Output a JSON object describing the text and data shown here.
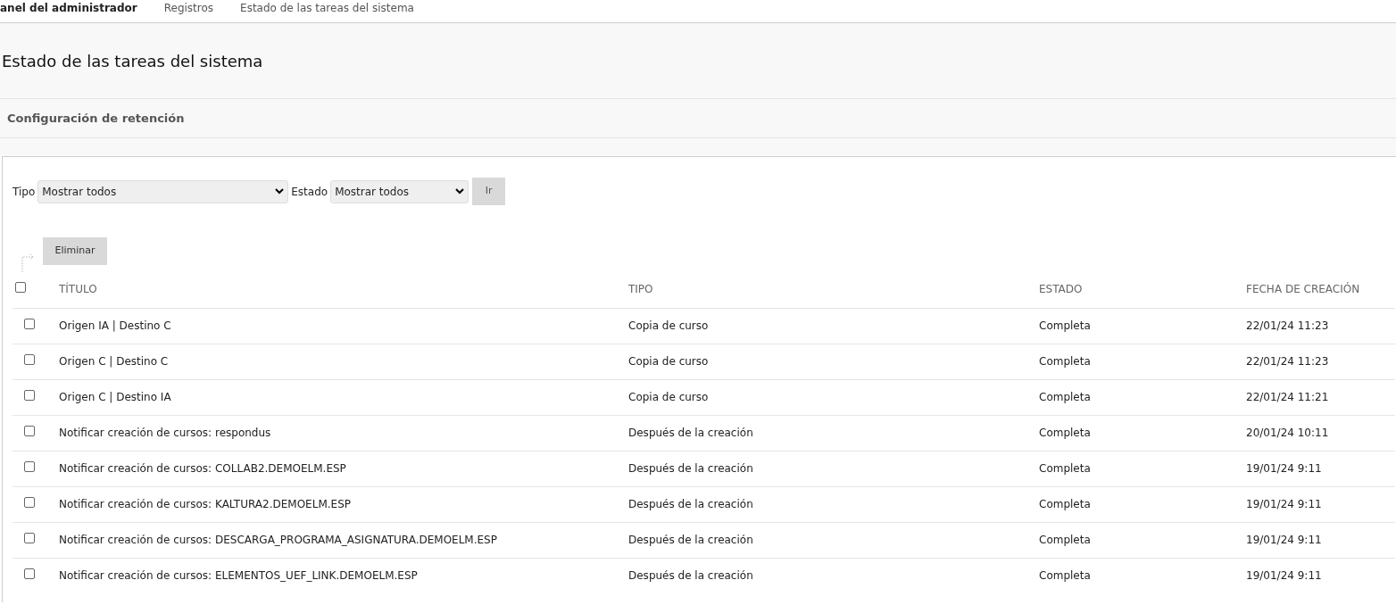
{
  "breadcrumbs": [
    "anel del administrador",
    "Registros",
    "Estado de las tareas del sistema"
  ],
  "page_title": "Estado de las tareas del sistema",
  "retention_link": "Configuración de retención",
  "filters": [
    {
      "label": "Tipo",
      "value": "Mostrar todos"
    },
    {
      "label": "Estado",
      "value": "Mostrar todos"
    }
  ],
  "go_button": "Ir",
  "delete_button": "Eliminar",
  "table": {
    "select_all": {
      "checked": false
    },
    "columns": [
      "TÍTULO",
      "TIPO",
      "ESTADO",
      "FECHA DE CREACIÓN"
    ],
    "rows": [
      {
        "checked": false,
        "cells": [
          "Origen IA | Destino C",
          "Copia de curso",
          "Completa",
          "22/01/24 11:23"
        ]
      },
      {
        "checked": false,
        "cells": [
          "Origen C | Destino C",
          "Copia de curso",
          "Completa",
          "22/01/24 11:23"
        ]
      },
      {
        "checked": false,
        "cells": [
          "Origen C | Destino IA",
          "Copia de curso",
          "Completa",
          "22/01/24 11:21"
        ]
      },
      {
        "checked": false,
        "cells": [
          "Notificar creación de cursos: respondus",
          "Después de la creación",
          "Completa",
          "20/01/24 10:11"
        ]
      },
      {
        "checked": false,
        "cells": [
          "Notificar creación de cursos: COLLAB2.DEMOELM.ESP",
          "Después de la creación",
          "Completa",
          "19/01/24 9:11"
        ]
      },
      {
        "checked": false,
        "cells": [
          "Notificar creación de cursos: KALTURA2.DEMOELM.ESP",
          "Después de la creación",
          "Completa",
          "19/01/24 9:11"
        ]
      },
      {
        "checked": false,
        "cells": [
          "Notificar creación de cursos: DESCARGA_PROGRAMA_ASIGNATURA.DEMOELM.ESP",
          "Después de la creación",
          "Completa",
          "19/01/24 9:11"
        ]
      },
      {
        "checked": false,
        "cells": [
          "Notificar creación de cursos: ELEMENTOS_UEF_LINK.DEMOELM.ESP",
          "Después de la creación",
          "Completa",
          "19/01/24 9:11"
        ]
      }
    ]
  }
}
